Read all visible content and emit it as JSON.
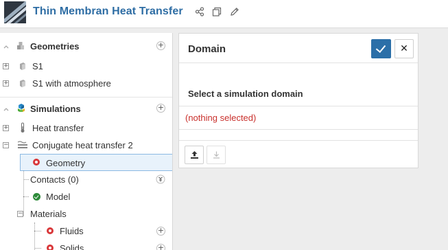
{
  "header": {
    "title": "Thin Membran Heat Transfer",
    "icons": [
      "share-icon",
      "copy-icon",
      "edit-icon"
    ]
  },
  "tree": {
    "geometries": {
      "label": "Geometries",
      "items": [
        {
          "label": "S1"
        },
        {
          "label": "S1 with atmosphere"
        }
      ]
    },
    "simulations": {
      "label": "Simulations",
      "items": [
        {
          "label": "Heat transfer"
        },
        {
          "label": "Conjugate heat transfer 2"
        }
      ],
      "children": {
        "geometry": "Geometry",
        "contacts": "Contacts (0)",
        "model": "Model",
        "materials": "Materials",
        "fluids": "Fluids",
        "solids": "Solids"
      }
    }
  },
  "panel": {
    "title": "Domain",
    "prompt": "Select a simulation domain",
    "selection": "(nothing selected)"
  },
  "colors": {
    "brand": "#2e6da4",
    "confirm": "#2b6fa8",
    "warning_text": "#c9302c",
    "status_ok": "#2e8b3a",
    "status_error": "#d9383a"
  }
}
